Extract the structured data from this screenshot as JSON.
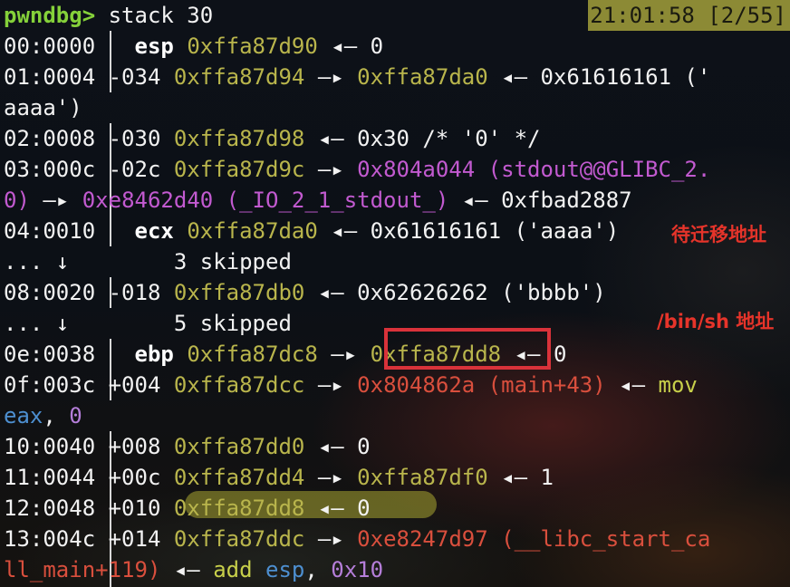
{
  "prompt": {
    "name": "pwndbg>",
    "command": "stack 30"
  },
  "status": {
    "time": "21:01:58",
    "counter": "[2/55]"
  },
  "symbols": {
    "arrow_left": "◂—",
    "arrow_right": "—▸",
    "down_arrow": "↓",
    "ellipsis": "..."
  },
  "rows": [
    {
      "idx": "00:0000",
      "off": " esp ",
      "addr": "0xffa87d90",
      "arrow": "◂—",
      "val": "0"
    },
    {
      "idx": "01:0004",
      "off": "-034",
      "addr": "0xffa87d94",
      "arrow": "—▸",
      "ptr": "0xffa87da0",
      "arrow2": "◂—",
      "val": "0x61616161 ('",
      "wrap": "aaaa')"
    },
    {
      "idx": "02:0008",
      "off": "-030",
      "addr": "0xffa87d98",
      "arrow": "◂—",
      "val": "0x30 /* '0' */"
    },
    {
      "idx": "03:000c",
      "off": "-02c",
      "addr": "0xffa87d9c",
      "arrow": "—▸",
      "ptr": "0x804a044 (stdout@@GLIBC_2.",
      "wrap_a": "0)",
      "wrap_arrow": "—▸",
      "wrap_ptr": "0xe8462d40 (_IO_2_1_stdout_)",
      "wrap_arrow2": "◂—",
      "wrap_val": "0xfbad2887"
    },
    {
      "idx": "04:0010",
      "off": " ecx ",
      "addr": "0xffa87da0",
      "arrow": "◂—",
      "val": "0x61616161 ('aaaa')"
    },
    {
      "skipped": "3 skipped"
    },
    {
      "idx": "08:0020",
      "off": "-018",
      "addr": "0xffa87db0",
      "arrow": "◂—",
      "val": "0x62626262 ('bbbb')"
    },
    {
      "skipped": "5 skipped"
    },
    {
      "idx": "0e:0038",
      "off": " ebp ",
      "addr": "0xffa87dc8",
      "arrow": "—▸",
      "ptr": "0xffa87dd8",
      "arrow2": "◂—",
      "val": "0"
    },
    {
      "idx": "0f:003c",
      "off": "+004",
      "addr": "0xffa87dcc",
      "arrow": "—▸",
      "ptr": "0x804862a (main+43)",
      "arrow2": "◂—",
      "val": "mov",
      "wrap_reg": "eax",
      "wrap_comma": ", ",
      "wrap_num": "0"
    },
    {
      "idx": "10:0040",
      "off": "+008",
      "addr": "0xffa87dd0",
      "arrow": "◂—",
      "val": "0"
    },
    {
      "idx": "11:0044",
      "off": "+00c",
      "addr": "0xffa87dd4",
      "arrow": "—▸",
      "ptr": "0xffa87df0",
      "arrow2": "◂—",
      "val": "1"
    },
    {
      "idx": "12:0048",
      "off": "+010",
      "addr": "0xffa87dd8",
      "arrow": "◂—",
      "val": "0"
    },
    {
      "idx": "13:004c",
      "off": "+014",
      "addr": "0xffa87ddc",
      "arrow": "—▸",
      "ptr": "0xe8247d97 (__libc_start_ca",
      "wrap_ptr": "ll_main+119)",
      "wrap_arrow": "◂—",
      "wrap_kw": "add",
      "wrap_reg": "esp",
      "wrap_comma": ", ",
      "wrap_num": "0x10"
    }
  ],
  "annotations": {
    "migrate": "待迁移地址",
    "binsh": "/bin/sh 地址"
  },
  "colors": {
    "prompt": "#85d13a",
    "address": "#b9b54c",
    "pointer_data": "#c25ad0",
    "pointer_code": "#d94f3d",
    "annotation": "#e6342a",
    "status_bg": "#8c8a35"
  }
}
